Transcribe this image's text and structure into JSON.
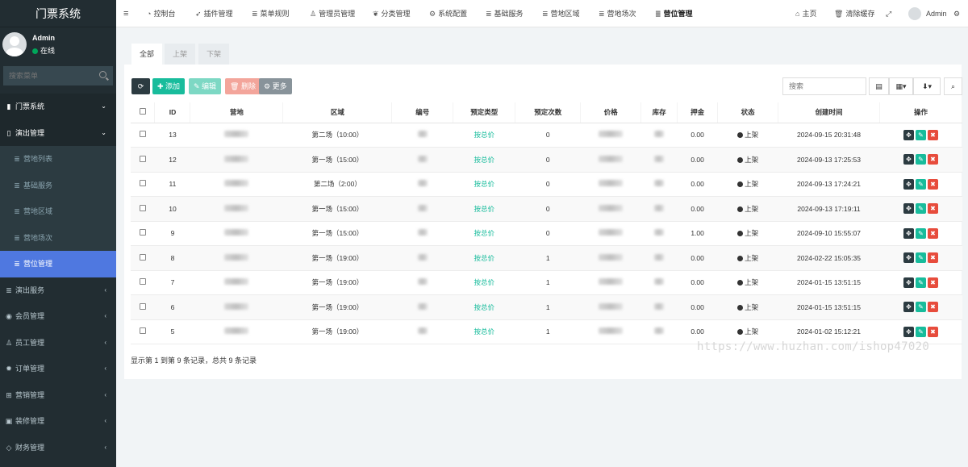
{
  "app": {
    "title": "门票系统"
  },
  "user": {
    "name": "Admin",
    "status": "在线"
  },
  "sidebar": {
    "search_placeholder": "搜索菜单",
    "items": [
      {
        "label": "门票系统",
        "icon": "book-icon",
        "arrow": "⌄",
        "level": "top"
      },
      {
        "label": "演出管理",
        "icon": "book-open-icon",
        "arrow": "⌄",
        "level": "top"
      },
      {
        "label": "营地列表",
        "icon": "list-icon",
        "level": "sub"
      },
      {
        "label": "基础服务",
        "icon": "list-icon",
        "level": "sub"
      },
      {
        "label": "营地区域",
        "icon": "list-icon",
        "level": "sub"
      },
      {
        "label": "营地场次",
        "icon": "list-icon",
        "level": "sub"
      },
      {
        "label": "营位管理",
        "icon": "list-icon",
        "level": "sub",
        "active": true
      },
      {
        "label": "演出服务",
        "icon": "list-icon",
        "arrow": "‹"
      },
      {
        "label": "会员管理",
        "icon": "user-circle-icon",
        "arrow": "‹"
      },
      {
        "label": "员工管理",
        "icon": "user-icon",
        "arrow": "‹"
      },
      {
        "label": "订单管理",
        "icon": "gear-icon",
        "arrow": "‹"
      },
      {
        "label": "营销管理",
        "icon": "cart-icon",
        "arrow": "‹"
      },
      {
        "label": "装修管理",
        "icon": "image-icon",
        "arrow": "‹"
      },
      {
        "label": "财务管理",
        "icon": "diamond-icon",
        "arrow": "‹"
      }
    ]
  },
  "topnav": {
    "menu_icon": "≡",
    "items": [
      {
        "label": "控制台",
        "icon": "dashboard-icon"
      },
      {
        "label": "插件管理",
        "icon": "rocket-icon"
      },
      {
        "label": "菜单规则",
        "icon": "list-icon"
      },
      {
        "label": "管理员管理",
        "icon": "user-icon"
      },
      {
        "label": "分类管理",
        "icon": "leaf-icon"
      },
      {
        "label": "系统配置",
        "icon": "gear-icon"
      },
      {
        "label": "基础服务",
        "icon": "list-icon"
      },
      {
        "label": "营地区域",
        "icon": "list-icon"
      },
      {
        "label": "营地场次",
        "icon": "list-icon"
      },
      {
        "label": "营位管理",
        "icon": "list-icon",
        "active": true
      }
    ],
    "home": "主页",
    "clear_cache": "清除缓存",
    "admin": "Admin"
  },
  "tabs": [
    {
      "label": "全部",
      "active": true
    },
    {
      "label": "上架"
    },
    {
      "label": "下架"
    }
  ],
  "toolbar": {
    "add": "添加",
    "edit": "编辑",
    "delete": "删除",
    "more": "更多",
    "search_placeholder": "搜索"
  },
  "table": {
    "columns": [
      "ID",
      "营地",
      "区域",
      "编号",
      "预定类型",
      "预定次数",
      "价格",
      "库存",
      "押金",
      "状态",
      "创建时间",
      "操作"
    ],
    "rows": [
      {
        "id": "13",
        "area": "第二场（10:00）",
        "type": "按总价",
        "count": "0",
        "deposit": "0.00",
        "status": "上架",
        "created": "2024-09-15 20:31:48"
      },
      {
        "id": "12",
        "area": "第一场（15:00）",
        "type": "按总价",
        "count": "0",
        "deposit": "0.00",
        "status": "上架",
        "created": "2024-09-13 17:25:53"
      },
      {
        "id": "11",
        "area": "第二场（2:00）",
        "type": "按总价",
        "count": "0",
        "deposit": "0.00",
        "status": "上架",
        "created": "2024-09-13 17:24:21"
      },
      {
        "id": "10",
        "area": "第一场（15:00）",
        "type": "按总价",
        "count": "0",
        "deposit": "0.00",
        "status": "上架",
        "created": "2024-09-13 17:19:11"
      },
      {
        "id": "9",
        "area": "第一场（15:00）",
        "type": "按总价",
        "count": "0",
        "deposit": "1.00",
        "status": "上架",
        "created": "2024-09-10 15:55:07"
      },
      {
        "id": "8",
        "area": "第一场（19:00）",
        "type": "按总价",
        "count": "1",
        "deposit": "0.00",
        "status": "上架",
        "created": "2024-02-22 15:05:35"
      },
      {
        "id": "7",
        "area": "第一场（19:00）",
        "type": "按总价",
        "count": "1",
        "deposit": "0.00",
        "status": "上架",
        "created": "2024-01-15 13:51:15"
      },
      {
        "id": "6",
        "area": "第一场（19:00）",
        "type": "按总价",
        "count": "1",
        "deposit": "0.00",
        "status": "上架",
        "created": "2024-01-15 13:51:15"
      },
      {
        "id": "5",
        "area": "第一场（19:00）",
        "type": "按总价",
        "count": "1",
        "deposit": "0.00",
        "status": "上架",
        "created": "2024-01-02 15:12:21"
      }
    ]
  },
  "pager": {
    "text": "显示第 1 到第 9 条记录，总共 9 条记录"
  },
  "watermark": "https://www.huzhan.com/ishop47020"
}
